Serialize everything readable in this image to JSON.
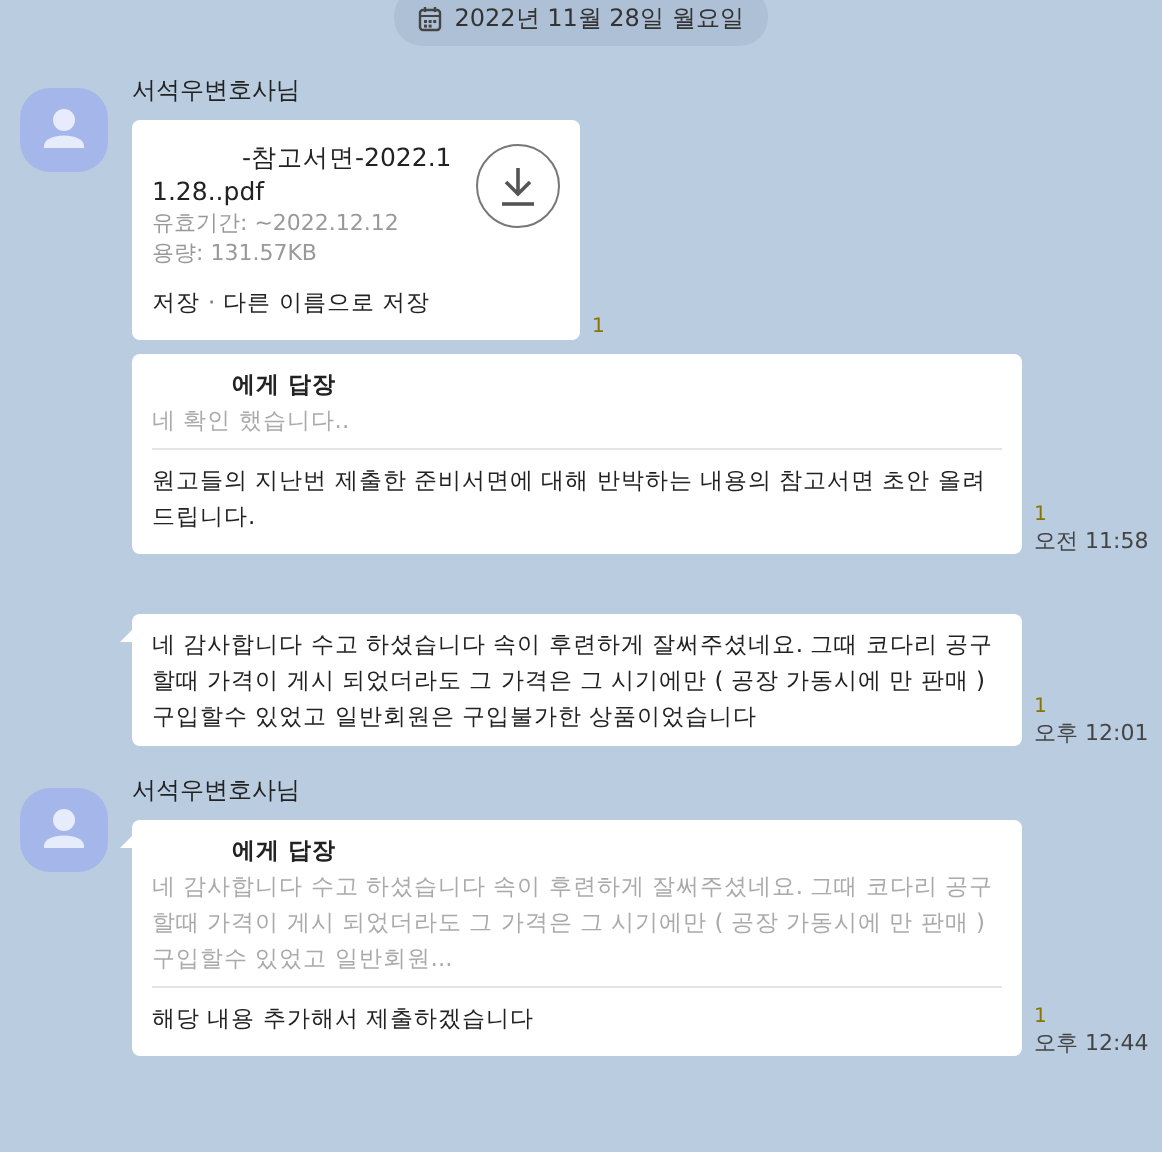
{
  "date_divider": "2022년 11월 28일 월요일",
  "messages": [
    {
      "kind": "file",
      "show_sender": true,
      "sender": "서석우변호사님",
      "tail": false,
      "file": {
        "name": "-참고서면-2022.11.28..pdf",
        "expiry": "유효기간: ~2022.12.12",
        "size": "용량: 131.57KB",
        "save": "저장",
        "separator": "·",
        "save_as": "다른 이름으로 저장"
      },
      "unread": "1"
    },
    {
      "kind": "reply",
      "show_sender": false,
      "tail": false,
      "reply_to": "에게 답장",
      "quoted": "네 확인 했습니다..",
      "text": "원고들의 지난번 제출한 준비서면에 대해 반박하는 내용의 참고서면 초안 올려드립니다.",
      "unread": "1",
      "time": "오전 11:58"
    },
    {
      "kind": "text",
      "show_sender": false,
      "tail": true,
      "text": "네 감사합니다 수고 하셨습니다 속이 후련하게 잘써주셨네요. 그때 코다리 공구할때 가격이 게시 되었더라도 그 가격은 그 시기에만 ( 공장 가동시에 만 판매 ) 구입할수 있었고 일반회원은 구입불가한 상품이었습니다",
      "unread": "1",
      "time": "오후 12:01"
    },
    {
      "kind": "reply",
      "show_sender": true,
      "sender": "서석우변호사님",
      "tail": true,
      "reply_to": "에게 답장",
      "quoted": "네 감사합니다 수고 하셨습니다 속이 후련하게 잘써주셨네요. 그때 코다리 공구할때 가격이 게시 되었더라도 그 가격은 그 시기에만 ( 공장 가동시에 만 판매 ) 구입할수 있었고 일반회원...",
      "text": "해당 내용 추가해서 제출하겠습니다",
      "unread": "1",
      "time": "오후 12:44"
    }
  ]
}
